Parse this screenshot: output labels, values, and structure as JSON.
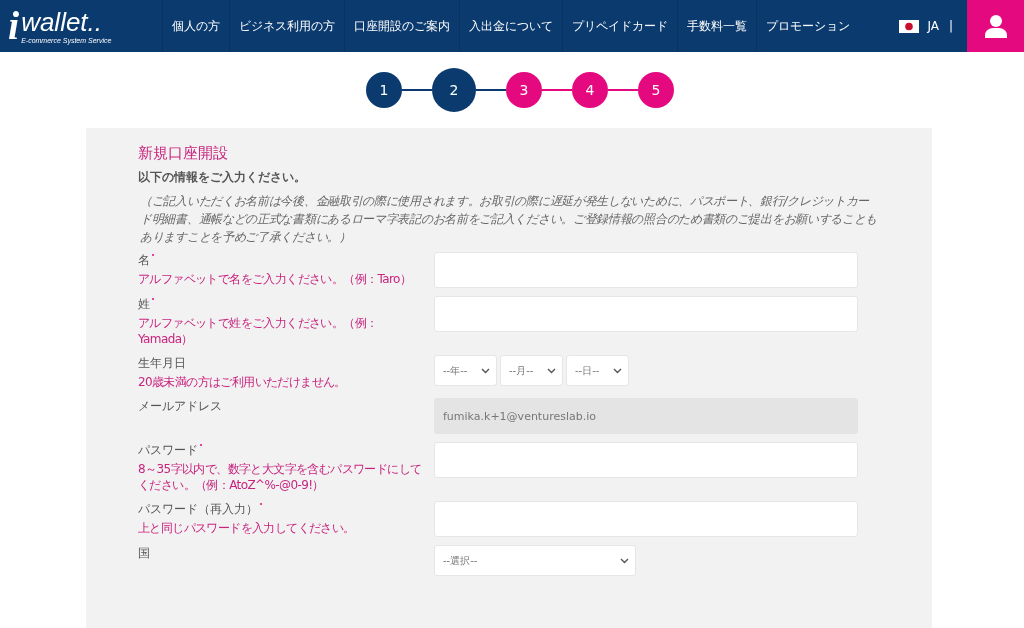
{
  "header": {
    "logo": {
      "mark": "i",
      "name": "wallet..",
      "tagline": "E-commerce System Service"
    },
    "nav": [
      "個人の方",
      "ビジネス利用の方",
      "口座開設のご案内",
      "入出金について",
      "プリペイドカード",
      "手数料一覧",
      "プロモーション"
    ],
    "language": "JA",
    "separator": "|"
  },
  "steps": [
    {
      "label": "1",
      "done": true,
      "selected": false
    },
    {
      "label": "2",
      "done": true,
      "selected": true
    },
    {
      "label": "3",
      "done": false,
      "selected": false
    },
    {
      "label": "4",
      "done": false,
      "selected": false
    },
    {
      "label": "5",
      "done": false,
      "selected": false
    }
  ],
  "form": {
    "title": "新規口座開設",
    "subtitle": "以下の情報をご入力ください。",
    "note": "（ご記入いただくお名前は今後、金融取引の際に使用されます。お取引の際に遅延が発生しないために、パスポート、銀行/クレジットカード明細書、通帳などの正式な書類にあるローマ字表記のお名前をご記入ください。ご登録情報の照合のため書類のご提出をお願いすることもありますことを予めご了承ください。）",
    "fields": [
      {
        "kind": "text",
        "label": "名",
        "required": true,
        "hint": "アルファベットで名をご入力ください。（例：Taro）"
      },
      {
        "kind": "text",
        "label": "姓",
        "required": true,
        "hint": "アルファベットで姓をご入力ください。（例：Yamada）"
      },
      {
        "kind": "date",
        "label": "生年月日",
        "required": false,
        "hint": "20歳未満の方はご利用いただけません。",
        "options": [
          "--年--",
          "--月--",
          "--日--"
        ]
      },
      {
        "kind": "readonly",
        "label": "メールアドレス",
        "required": false,
        "value": "fumika.k+1@ventureslab.io"
      },
      {
        "kind": "text",
        "label": "パスワード",
        "required": true,
        "hint": "8～35字以内で、数字と大文字を含むパスワードにしてください。（例：AtoZ^%-@0-9!）"
      },
      {
        "kind": "text",
        "label": "パスワード（再入力）",
        "required": true,
        "hint": "上と同じパスワードを入力してください。"
      },
      {
        "kind": "select",
        "label": "国",
        "required": false,
        "options": [
          "--選択--"
        ]
      }
    ]
  }
}
